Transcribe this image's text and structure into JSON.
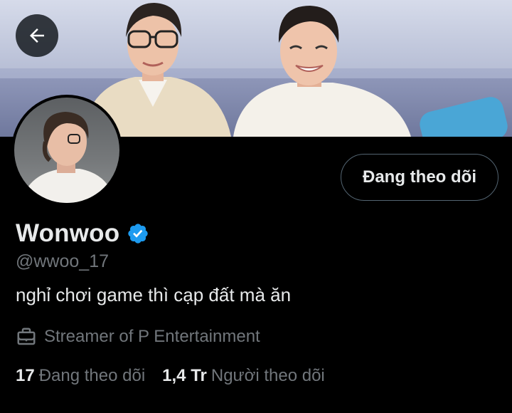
{
  "header": {
    "back_icon": "arrow-left-icon"
  },
  "profile": {
    "display_name": "Wonwoo",
    "verified_icon": "verified-badge-icon",
    "handle": "@wwoo_17",
    "bio": "nghỉ chơi game thì cạp đất mà ăn",
    "category": {
      "icon": "briefcase-icon",
      "label": "Streamer of P Entertainment"
    },
    "follow_button_label": "Đang theo dõi"
  },
  "stats": {
    "following": {
      "count": "17",
      "label": "Đang theo dõi"
    },
    "followers": {
      "count": "1,4 Tr",
      "label": "Người theo dõi"
    }
  },
  "colors": {
    "background": "#000000",
    "primary_text": "#e7e9ea",
    "secondary_text": "#71767b",
    "border": "#536471",
    "verified_blue": "#1d9bf0"
  }
}
